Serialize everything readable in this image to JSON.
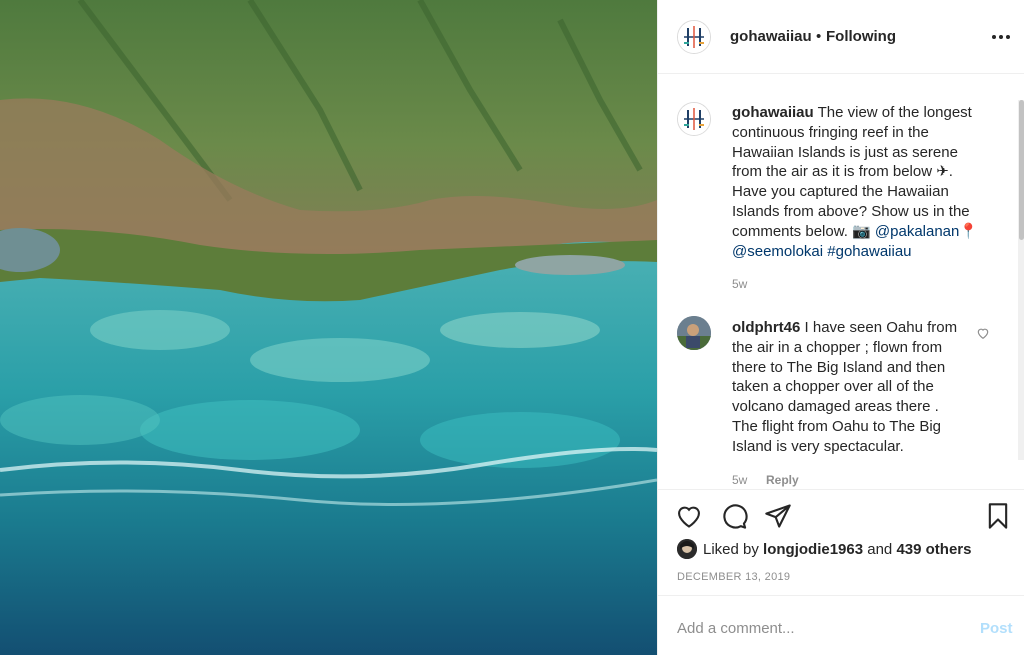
{
  "header": {
    "username": "gohawaiiau",
    "separator": "•",
    "follow_status": "Following"
  },
  "caption": {
    "username": "gohawaiiau",
    "text": "The view of the longest continuous fringing reef in the Hawaiian Islands is just as serene from the air as it is from below ✈. Have you captured the Hawaiian Islands from above? Show us in the comments below. 📷",
    "mention_1": "@pakalanan",
    "pin": "📍",
    "mention_2": "@seemolokai",
    "hashtag": "#gohawaiiau",
    "time": "5w"
  },
  "comment": {
    "username": "oldphrt46",
    "text": "I have seen Oahu from the air in a chopper ; flown from there to The Big Island and then taken a chopper over all of the volcano damaged areas there . The flight from Oahu to The Big Island is very spectacular.",
    "time": "5w",
    "reply_label": "Reply"
  },
  "likes": {
    "prefix": "Liked by",
    "user": "longjodie1963",
    "and": "and",
    "others": "439 others"
  },
  "post_date": "DECEMBER 13, 2019",
  "add_comment": {
    "placeholder": "Add a comment...",
    "post_label": "Post"
  },
  "colors": {
    "link": "#00376b",
    "post_button_disabled": "#b2dffc",
    "meta_gray": "#8e8e8e"
  },
  "icons": [
    "more-icon",
    "heart-icon",
    "comment-icon",
    "share-icon",
    "bookmark-icon",
    "comment-like-heart-icon"
  ]
}
